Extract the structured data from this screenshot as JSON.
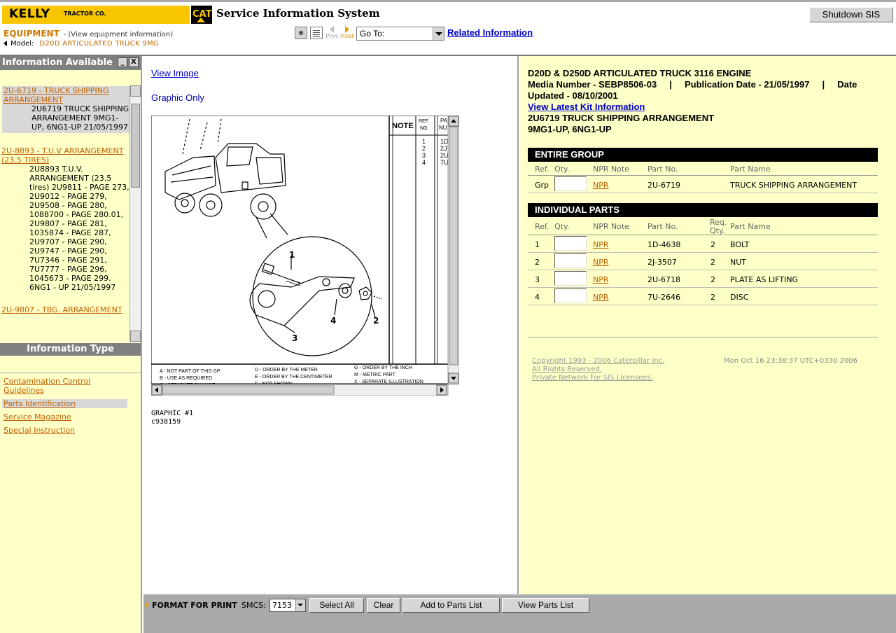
{
  "header": {
    "kelly_logo": "KELLY",
    "kelly_sub": "TRACTOR CO.",
    "cat_logo": "CAT",
    "system_title": "Service Information System",
    "shutdown_label": "Shutdown SIS",
    "equipment_label": "EQUIPMENT",
    "equipment_sub": "- (View equipment information)",
    "model_label": "Model:",
    "model_value": "D20D ARTICULATED TRUCK 9MG",
    "prev_label": "Prev",
    "next_label": "Next",
    "goto_value": "Go To:",
    "related_label": "Related Information"
  },
  "left": {
    "info_available_title": "Information Available",
    "minimize": "_",
    "close": "X",
    "items": [
      {
        "title": "2U-6719 - TRUCK SHIPPING ARRANGEMENT",
        "desc": "2U6719 TRUCK SHIPPING ARRANGEMENT 9MG1-UP, 6NG1-UP 21/05/1997"
      },
      {
        "title": "2U-8893 - T.U.V ARRANGEMENT (23.5 TIRES)",
        "desc": "2U8893 T.U.V. ARRANGEMENT (23.5 tires) 2U9811 - PAGE 273, 2U9012 - PAGE 279, 2U9508 - PAGE 280, 1088700 - PAGE 280.01, 2U9807 - PAGE 281, 1035874 - PAGE 287, 2U9707 - PAGE 290, 2U9747 - PAGE 290, 7U7346 - PAGE 291, 7U7777 - PAGE 296, 1045673 - PAGE 299. 6NG1 - UP 21/05/1997"
      },
      {
        "title": "2U-9807 - TBG. ARRANGEMENT",
        "desc": ""
      }
    ],
    "info_type_title": "Information Type",
    "types": [
      "Contamination Control Guidelines",
      "Parts Identification",
      "Service Magazine",
      "Special Instruction"
    ]
  },
  "center": {
    "view_image": "View Image",
    "graphic_only": "Graphic Only",
    "graphic_label": "GRAPHIC #1",
    "graphic_id": "c938159",
    "drawing": {
      "col_note": "NOTE",
      "col_ref": "REF.",
      "col_ref2": "NO.",
      "col_part": "PA",
      "col_part2": "NU",
      "refs": [
        "1",
        "2",
        "3",
        "4"
      ],
      "part_frags": [
        "1D",
        "2J",
        "2U",
        "7U"
      ],
      "callouts": [
        "1",
        "2",
        "3",
        "4"
      ],
      "legend": [
        "A - NOT PART OF THIS GP.",
        "B - USE AS REQUIRED",
        "C - SEPARATE CHANGE",
        "D - ORDER BY THE METER",
        "E - ORDER BY THE CENTIMETER",
        "F - NOT SHOWN",
        "G - ORDER BY THE INCH",
        "M - METRIC PART",
        "X - SEPARATE ILLUSTRATION"
      ]
    }
  },
  "right": {
    "title_line1": "D20D & D250D ARTICULATED TRUCK 3116 ENGINE",
    "title_line2": "Media Number - SEBP8506-03     |     Publication Date - 21/05/1997     |     Date",
    "title_line3": "Updated - 08/10/2001",
    "kit_link": "View Latest Kit Information",
    "title_line4": "2U6719 TRUCK SHIPPING ARRANGEMENT",
    "title_line5": "9MG1-UP, 6NG1-UP",
    "entire_group": "ENTIRE GROUP",
    "individual_parts": "INDIVIDUAL PARTS",
    "headers": {
      "ref": "Ref.",
      "qty": "Qty.",
      "npr": "NPR Note",
      "part_no": "Part No.",
      "req": "Req.",
      "req2": "Qty.",
      "part_name": "Part Name"
    },
    "group_row": {
      "ref": "Grp",
      "npr": "NPR",
      "part_no": "2U-6719",
      "part_name": "TRUCK SHIPPING ARRANGEMENT"
    },
    "parts": [
      {
        "ref": "1",
        "npr": "NPR",
        "part_no": "1D-4638",
        "req": "2",
        "part_name": "BOLT"
      },
      {
        "ref": "2",
        "npr": "NPR",
        "part_no": "2J-3507",
        "req": "2",
        "part_name": "NUT"
      },
      {
        "ref": "3",
        "npr": "NPR",
        "part_no": "2U-6718",
        "req": "2",
        "part_name": "PLATE AS LIFTING"
      },
      {
        "ref": "4",
        "npr": "NPR",
        "part_no": "7U-2646",
        "req": "2",
        "part_name": "DISC"
      }
    ],
    "copyright1": "Copyright 1993 - 2006 Caterpillar Inc.",
    "copyright2": "All Rights Reserved.",
    "copyright3": "Private Network For SIS Licensees.",
    "datestamp": "Mon Oct 16 23:38:37 UTC+0330 2006"
  },
  "bottom": {
    "format_label": "FORMAT FOR PRINT",
    "smcs_label": "SMCS:",
    "smcs_value": "7153",
    "select_all": "Select All",
    "clear": "Clear",
    "add_to_parts": "Add to Parts List",
    "view_parts": "View Parts List"
  }
}
